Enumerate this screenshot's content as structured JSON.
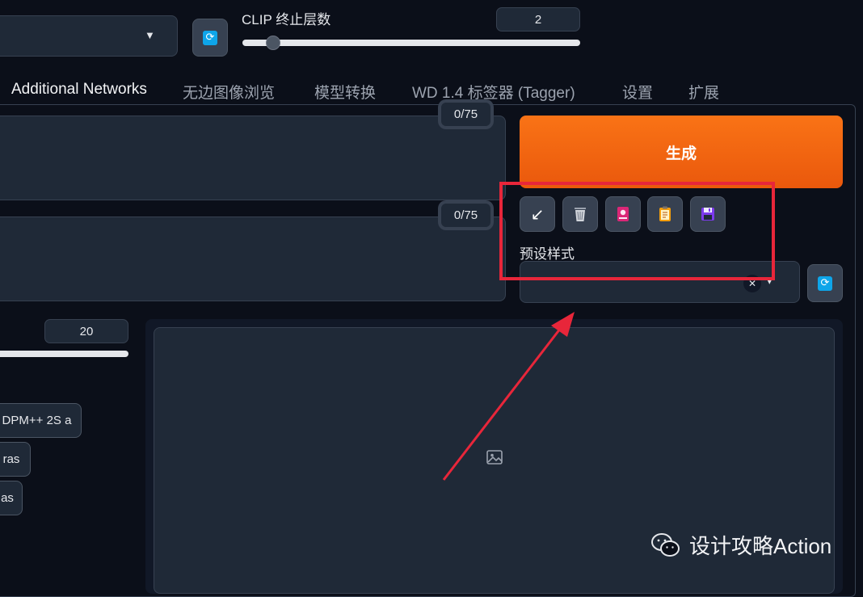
{
  "top": {
    "clip_label": "CLIP 终止层数",
    "clip_value": "2",
    "clip_slider_fraction": 0.09,
    "refresh_icon": "refresh-icon"
  },
  "tabs": [
    {
      "label": "Additional Networks",
      "active": true
    },
    {
      "label": "无边图像浏览"
    },
    {
      "label": "模型转换"
    },
    {
      "label": "WD 1.4 标签器 (Tagger)"
    },
    {
      "label": "设置"
    },
    {
      "label": "扩展"
    }
  ],
  "prompt": {
    "token_count": "0/75"
  },
  "negative_prompt": {
    "token_count": "0/75"
  },
  "generate_button": {
    "label": "生成"
  },
  "toolbar": {
    "icons": [
      "arrow-down-left-icon",
      "trash-icon",
      "card-icon",
      "clipboard-icon",
      "save-icon"
    ],
    "arrow_glyph": "↙"
  },
  "styles": {
    "label": "预设样式",
    "clear_glyph": "✕",
    "dropdown_glyph": "▾"
  },
  "steps": {
    "value": "20"
  },
  "samplers": [
    "DPM++ 2S a",
    "ras",
    "as"
  ],
  "image_panel": {
    "placeholder_icon": "image-icon"
  },
  "watermark": {
    "text": "设计攻略Action",
    "icon": "wechat-icon"
  },
  "colors": {
    "accent_orange": "#f97316",
    "highlight_red": "#e8263a",
    "refresh_blue": "#0ea5e9"
  }
}
